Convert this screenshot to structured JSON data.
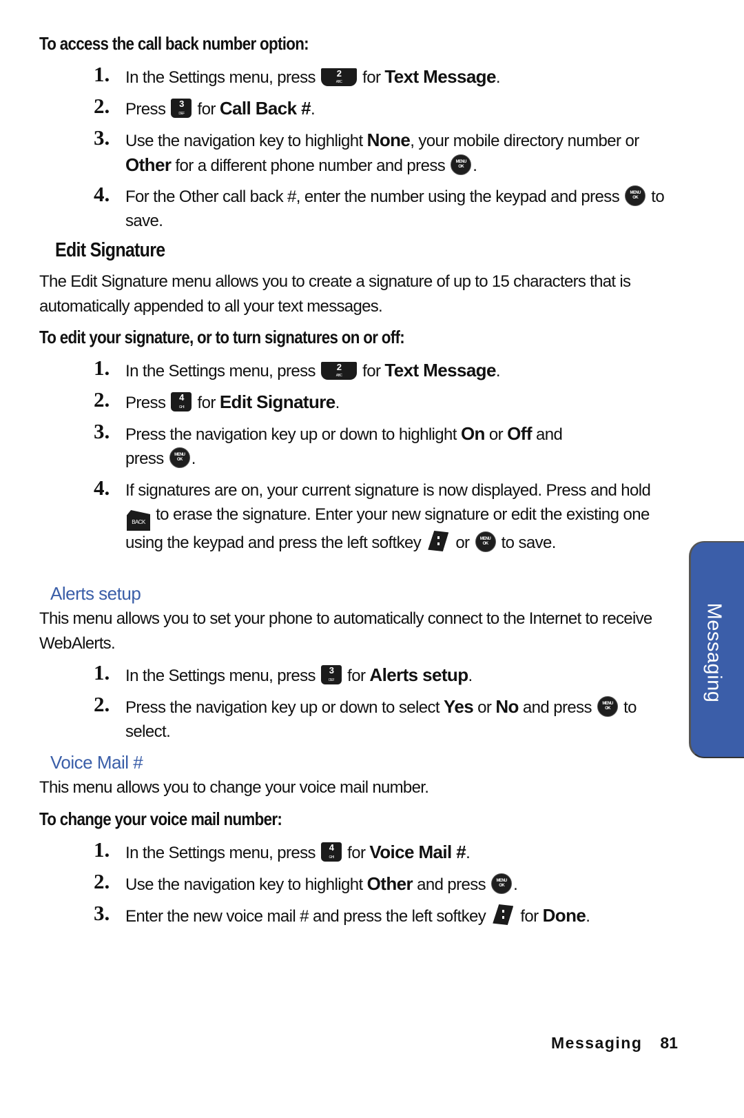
{
  "section1": {
    "heading": "To access the call back number option:",
    "steps": [
      {
        "num": "1.",
        "pre": "In the Settings menu, press",
        "key": {
          "num": "2",
          "letters": "ABC"
        },
        "mid": "for",
        "bold": "Text Message",
        "post": "."
      },
      {
        "num": "2.",
        "pre": "Press",
        "key": {
          "num": "3",
          "letters": "DEF"
        },
        "mid": "for",
        "bold": "Call Back #",
        "post": "."
      },
      {
        "num": "3.",
        "t1": "Use the navigation key to highlight",
        "b1": "None",
        "t2": ", your mobile directory number or",
        "b2": "Other",
        "t3": "for a different phone number and press",
        "post": "."
      },
      {
        "num": "4.",
        "t1": "For the Other call back #, enter the number using the keypad and press",
        "t2": "to save."
      }
    ]
  },
  "edit_signature": {
    "title": "Edit Signature",
    "description": "The Edit Signature menu allows you to create a signature of up to 15 characters that is automatically appended to all your text messages.",
    "procedure_heading": "To edit your signature, or to turn signatures on or off:",
    "steps": [
      {
        "num": "1.",
        "pre": "In the Settings menu, press",
        "key": {
          "num": "2",
          "letters": "ABC"
        },
        "mid": "for",
        "bold": "Text Message",
        "post": "."
      },
      {
        "num": "2.",
        "pre": "Press",
        "key": {
          "num": "4",
          "letters": "GHI"
        },
        "mid": "for",
        "bold": "Edit Signature",
        "post": "."
      },
      {
        "num": "3.",
        "t1": "Press the navigation key up or down to highlight",
        "b1": "On",
        "t2": "or",
        "b2": "Off",
        "t3": "and press",
        "post": "."
      },
      {
        "num": "4.",
        "t1": "If signatures are on, your current signature is now displayed. Press and hold",
        "back_label": "BACK",
        "t2": "to erase the signature. Enter your new signature or edit the existing one using the keypad and press the left softkey",
        "t3": "or",
        "t4": "to save."
      }
    ]
  },
  "alerts_setup": {
    "title": "Alerts setup",
    "description": "This menu allows you to set your phone to automatically connect to the Internet to receive WebAlerts.",
    "steps": [
      {
        "num": "1.",
        "pre": "In the Settings menu, press",
        "key": {
          "num": "3",
          "letters": "DEF"
        },
        "mid": "for",
        "bold": "Alerts setup",
        "post": "."
      },
      {
        "num": "2.",
        "t1": "Press the navigation key up or down to select",
        "b1": "Yes",
        "t2": "or",
        "b2": "No",
        "t3": "and press",
        "t4": "to select."
      }
    ]
  },
  "voice_mail": {
    "title": "Voice Mail #",
    "description": "This menu allows you to change your voice mail number.",
    "procedure_heading": "To change your voice mail number:",
    "steps": [
      {
        "num": "1.",
        "pre": "In the Settings menu, press",
        "key": {
          "num": "4",
          "letters": "GHI"
        },
        "mid": "for",
        "bold": "Voice Mail #",
        "post": "."
      },
      {
        "num": "2.",
        "t1": "Use the navigation key to highlight",
        "b1": "Other",
        "t2": "and press",
        "post": "."
      },
      {
        "num": "3.",
        "t1": "Enter the new voice mail # and press the left softkey",
        "t2": "for",
        "b1": "Done",
        "post": "."
      }
    ]
  },
  "ok_button": {
    "line1": "MENU",
    "line2": "OK"
  },
  "side_tab": {
    "label": "Messaging",
    "color": "#3b5ea9"
  },
  "footer": {
    "section": "Messaging",
    "page": "81"
  },
  "colors": {
    "subheading_blue": "#3a5ea8"
  }
}
